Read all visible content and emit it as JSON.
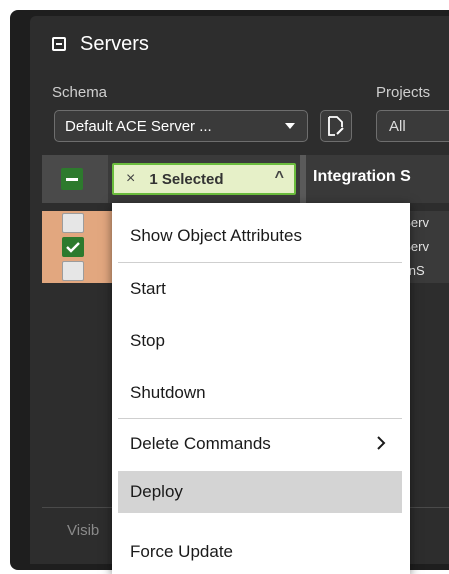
{
  "panel": {
    "title": "Servers"
  },
  "schema": {
    "label": "Schema",
    "selected": "Default ACE Server ..."
  },
  "projects": {
    "label": "Projects",
    "selected": "All"
  },
  "table": {
    "selection_chip": {
      "close_glyph": "×",
      "label": "1 Selected",
      "chevron_glyph": "^"
    },
    "column_header": "Integration S",
    "rows": [
      {
        "checked": false,
        "text": "nServ"
      },
      {
        "checked": true,
        "text": "nServ"
      },
      {
        "checked": false,
        "text": "tionS"
      }
    ]
  },
  "footer": {
    "text": "Visib"
  },
  "context_menu": {
    "items": [
      {
        "label": "Show Object Attributes",
        "highlighted": false
      },
      {
        "label": "Start",
        "highlighted": false
      },
      {
        "label": "Stop",
        "highlighted": false
      },
      {
        "label": "Shutdown",
        "highlighted": false
      },
      {
        "label": "Delete Commands",
        "highlighted": false,
        "submenu": true
      },
      {
        "label": "Deploy",
        "highlighted": true
      },
      {
        "label": "Force Update",
        "highlighted": false
      }
    ]
  },
  "colors": {
    "background": "#2d2d2d",
    "checkbox_green": "#2d7a2d",
    "chip_border": "#6bbd3d",
    "row_highlight": "#e2a77f",
    "menu_highlight": "#d4d4d4"
  }
}
